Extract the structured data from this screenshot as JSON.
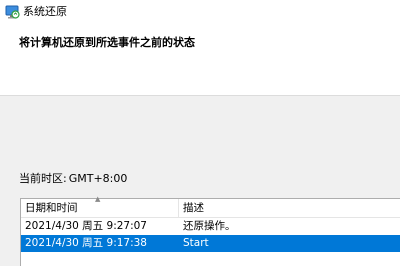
{
  "window": {
    "title": "系统还原"
  },
  "header": {
    "heading": "将计算机还原到所选事件之前的状态"
  },
  "timezone": {
    "label": "当前时区:",
    "value": "GMT+8:00"
  },
  "restore_list": {
    "columns": [
      "日期和时间",
      "描述"
    ],
    "rows": [
      {
        "datetime": "2021/4/30 周五 9:27:07",
        "description": "还原操作。",
        "selected": false
      },
      {
        "datetime": "2021/4/30 周五 9:17:38",
        "description": "Start",
        "selected": true
      }
    ]
  },
  "colors": {
    "selection": "#0078d7",
    "background": "#f0f0f0"
  },
  "icons": {
    "app": "system-restore-icon",
    "sort": "sort-ascending-icon"
  }
}
